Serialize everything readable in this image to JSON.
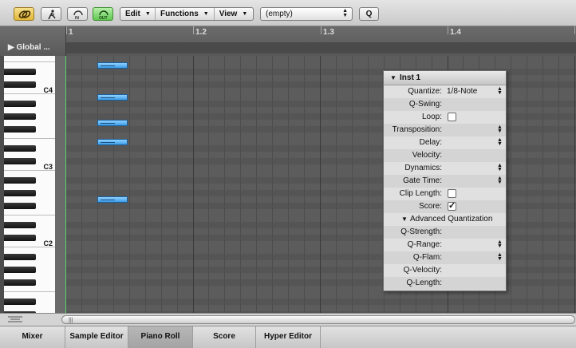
{
  "toolbar": {
    "buttons": [
      {
        "name": "link-icon"
      },
      {
        "name": "catch-icon"
      },
      {
        "name": "midi-in-icon",
        "label": "IN"
      },
      {
        "name": "midi-out-icon",
        "label": "OUT"
      }
    ],
    "menus": [
      {
        "label": "Edit"
      },
      {
        "label": "Functions"
      },
      {
        "label": "View"
      }
    ],
    "quantize_select": "(empty)",
    "q_button": "Q"
  },
  "global_tracks_label": "▶ Global ...",
  "ruler": {
    "bars": [
      "1",
      "1.2",
      "1.3",
      "1.4"
    ]
  },
  "keyboard": {
    "octave_labels": [
      "C4",
      "C3",
      "C2"
    ]
  },
  "notes": [
    {
      "beat": 2,
      "length": 1,
      "pitch": "E4"
    },
    {
      "beat": 2,
      "length": 1,
      "pitch": "B3"
    },
    {
      "beat": 2,
      "length": 1,
      "pitch": "G3"
    },
    {
      "beat": 2,
      "length": 1,
      "pitch": "E3"
    },
    {
      "beat": 2,
      "length": 1,
      "pitch": "G2"
    }
  ],
  "inspector": {
    "title": "Inst 1",
    "params": [
      {
        "label": "Quantize:",
        "value": "1/8-Note",
        "stepper": true
      },
      {
        "label": "Q-Swing:",
        "value": ""
      },
      {
        "label": "Loop:",
        "checkbox": false
      },
      {
        "label": "Transposition:",
        "value": "",
        "stepper": true
      },
      {
        "label": "Delay:",
        "value": "",
        "stepper": true
      },
      {
        "label": "Velocity:",
        "value": ""
      },
      {
        "label": "Dynamics:",
        "value": "",
        "stepper": true
      },
      {
        "label": "Gate Time:",
        "value": "",
        "stepper": true
      },
      {
        "label": "Clip Length:",
        "checkbox": false
      },
      {
        "label": "Score:",
        "checkbox": true
      }
    ],
    "advanced_title": "Advanced Quantization",
    "advanced_params": [
      {
        "label": "Q-Strength:",
        "value": ""
      },
      {
        "label": "Q-Range:",
        "value": "",
        "stepper": true
      },
      {
        "label": "Q-Flam:",
        "value": "",
        "stepper": true
      },
      {
        "label": "Q-Velocity:",
        "value": ""
      },
      {
        "label": "Q-Length:",
        "value": ""
      }
    ]
  },
  "tabs": [
    {
      "label": "Mixer",
      "active": false
    },
    {
      "label": "Sample Editor",
      "active": false
    },
    {
      "label": "Piano Roll",
      "active": true
    },
    {
      "label": "Score",
      "active": false
    },
    {
      "label": "Hyper Editor",
      "active": false
    }
  ],
  "colors": {
    "note_fill": "#5bb3f5",
    "playhead": "#56d46a",
    "grid_bg": "#5c5c5c"
  }
}
